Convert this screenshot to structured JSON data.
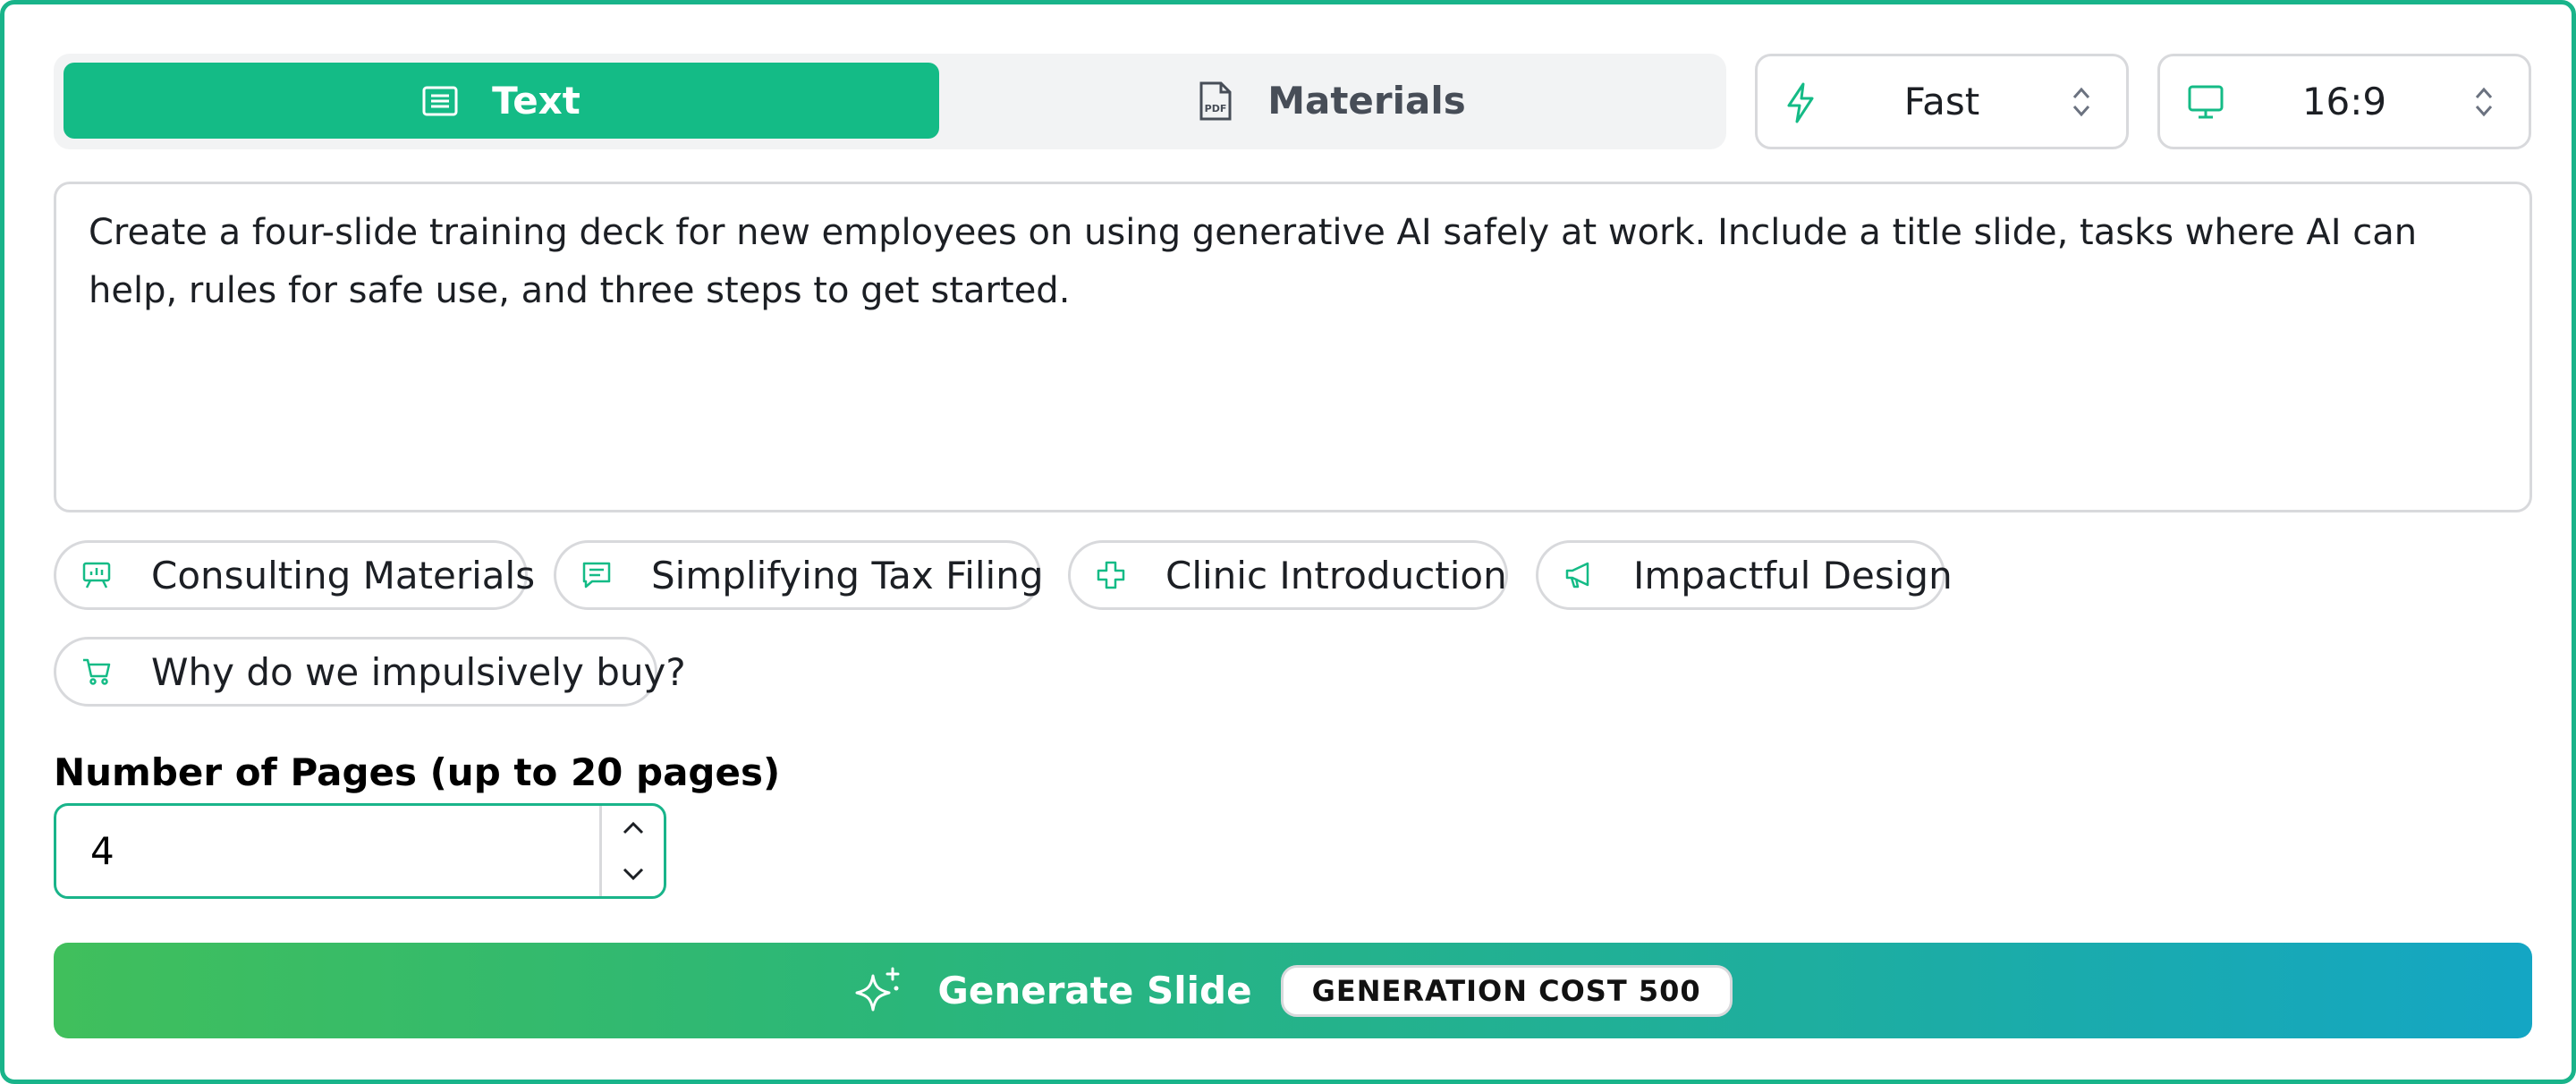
{
  "tabs": [
    {
      "label": "Text",
      "icon": "text-lines-icon",
      "active": true
    },
    {
      "label": "Materials",
      "icon": "pdf-file-icon",
      "active": false
    }
  ],
  "speed_select": {
    "value": "Fast",
    "icon": "lightning-icon"
  },
  "ratio_select": {
    "value": "16:9",
    "icon": "monitor-icon"
  },
  "prompt": {
    "value": "Create a four-slide training deck for new employees on using generative AI safely at work. Include a title slide, tasks where AI can help, rules for safe use, and three steps to get started."
  },
  "suggestions": [
    {
      "label": "Consulting Materials",
      "icon": "presentation-chart-icon"
    },
    {
      "label": "Simplifying Tax Filing",
      "icon": "message-lines-icon"
    },
    {
      "label": "Clinic Introduction",
      "icon": "medical-cross-icon"
    },
    {
      "label": "Impactful Design",
      "icon": "megaphone-icon"
    },
    {
      "label": "Why do we impulsively buy?",
      "icon": "shopping-cart-icon"
    }
  ],
  "pages": {
    "label": "Number of Pages (up to 20 pages)",
    "value": "4"
  },
  "generate": {
    "label": "Generate Slide",
    "cost": "GENERATION COST 500",
    "icon": "sparkles-icon"
  },
  "colors": {
    "accent": "#14bb86",
    "gradient_start": "#40bf5c",
    "gradient_end": "#14a6c4",
    "border": "#d8d9dc"
  }
}
